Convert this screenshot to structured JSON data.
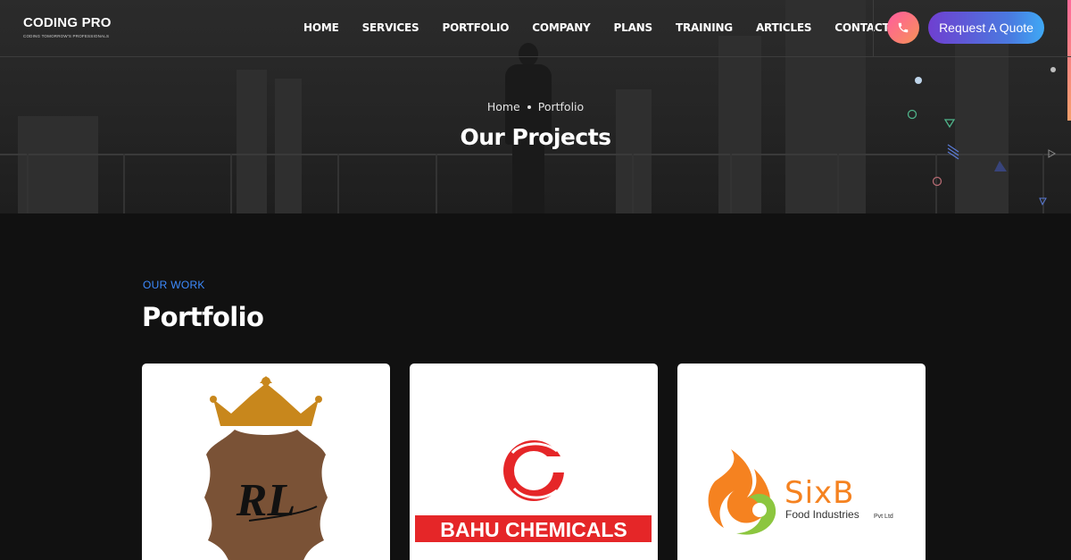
{
  "brand": {
    "name": "CODING PRO",
    "tagline": "CODING TOMORROW'S PROFESSIONALS"
  },
  "nav": {
    "items": [
      "HOME",
      "SERVICES",
      "PORTFOLIO",
      "COMPANY",
      "PLANS",
      "TRAINING",
      "ARTICLES",
      "CONTACT"
    ]
  },
  "header": {
    "phone_icon": "phone-icon",
    "quote_label": "Request A Quote"
  },
  "hero": {
    "breadcrumb": {
      "home": "Home",
      "current": "Portfolio"
    },
    "title": "Our Projects"
  },
  "section": {
    "label": "OUR WORK",
    "title": "Portfolio"
  },
  "portfolio": {
    "items": [
      {
        "logo_text": "RL"
      },
      {
        "logo_text": "BAHU CHEMICALS"
      },
      {
        "logo_text": "SixB",
        "logo_subtext": "Food Industries",
        "logo_suffix": "Pvt Ltd"
      }
    ]
  },
  "colors": {
    "accent_blue": "#3d8bff",
    "quote_gradient_start": "#6f3fd0",
    "quote_gradient_end": "#3fa9f5",
    "phone_gradient_start": "#ff5ba0",
    "phone_gradient_end": "#f79356",
    "page_bg": "#111111"
  }
}
